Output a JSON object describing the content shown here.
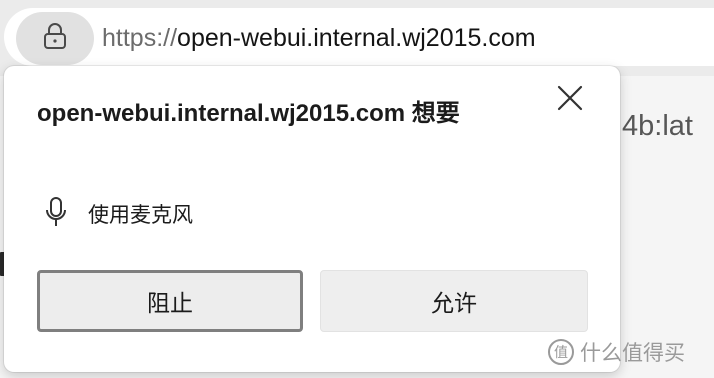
{
  "address_bar": {
    "url_scheme": "https://",
    "url_host": "open-webui.internal.wj2015.com"
  },
  "background": {
    "partial_text": "4b:lat"
  },
  "permission_popup": {
    "title": "open-webui.internal.wj2015.com 想要",
    "permission_label": "使用麦克风",
    "block_label": "阻止",
    "allow_label": "允许"
  },
  "watermark": {
    "badge": "值",
    "text": "什么值得买"
  },
  "icons": {
    "lock": "lock-icon",
    "close": "close-icon",
    "microphone": "microphone-icon"
  }
}
